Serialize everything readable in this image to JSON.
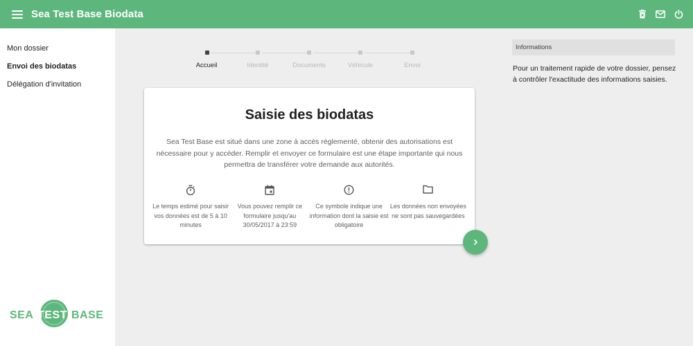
{
  "app": {
    "title": "Sea Test Base Biodata",
    "menu_icon": "hamburger-menu-icon",
    "actions": [
      {
        "icon": "trash-icon"
      },
      {
        "icon": "mail-icon"
      },
      {
        "icon": "power-icon"
      }
    ],
    "colors": {
      "primary": "#5db77c",
      "sidebar_bg": "#ffffff",
      "page_bg": "#eeeeee"
    }
  },
  "sidebar": {
    "items": [
      {
        "label": "Mon dossier",
        "active": false
      },
      {
        "label": "Envoi des biodatas",
        "active": true
      },
      {
        "label": "Délégation d'invitation",
        "active": false
      }
    ],
    "logo": {
      "text_left": "SEA",
      "text_right": "BASE",
      "text_center": "TEST"
    }
  },
  "stepper": {
    "steps": [
      {
        "label": "Accueil",
        "active": true
      },
      {
        "label": "Identité",
        "active": false
      },
      {
        "label": "Documents",
        "active": false
      },
      {
        "label": "Véhicule",
        "active": false
      },
      {
        "label": "Envoi",
        "active": false
      }
    ]
  },
  "card": {
    "title": "Saisie des biodatas",
    "intro": "Sea Test Base est situé dans une zone à accès réglementé, obtenir des autorisations est nécessaire pour y accèder. Remplir et envoyer ce formulaire est une étape importante qui nous permettra de transférer votre demande aux autorités.",
    "features": [
      {
        "icon": "timer-icon",
        "text": "Le temps estimé pour saisir vos données est de 5 à 10 minutes"
      },
      {
        "icon": "calendar-icon",
        "text": "Vous pouvez remplir ce formulaire jusqu'au 30/05/2017 à 23:59"
      },
      {
        "icon": "error-outline-icon",
        "text": "Ce symbole indique une information dont la saisie est obligatoire"
      },
      {
        "icon": "folder-icon",
        "text": "Les données non envoyées ne sont pas sauvegardées"
      }
    ]
  },
  "next_button": {
    "icon": "chevron-right-icon"
  },
  "info": {
    "header": "Informations",
    "text": "Pour un traitement rapide de votre dossier, pensez à contrôler l'exactitude des informations saisies."
  }
}
